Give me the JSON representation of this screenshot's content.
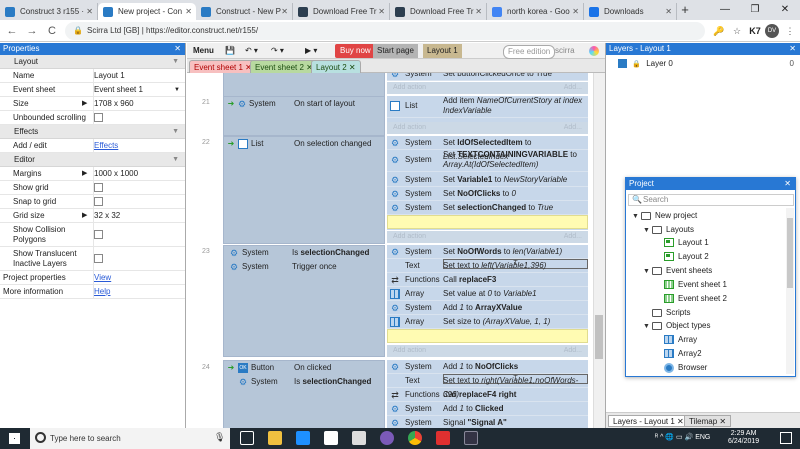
{
  "browser": {
    "tabs": [
      {
        "label": "Construct 3 r155 ·",
        "fav": "#2a7bc4"
      },
      {
        "label": "New project - Con",
        "fav": "#2a7bc4"
      },
      {
        "label": "Construct - New P",
        "fav": "#2a7bc4"
      },
      {
        "label": "Download Free Tr",
        "fav": "#2c3e50"
      },
      {
        "label": "Download Free Tr",
        "fav": "#2c3e50"
      },
      {
        "label": "north korea - Goo",
        "fav": "#4285f4"
      },
      {
        "label": "Downloads",
        "fav": "#1a73e8"
      }
    ],
    "close_glyph": "✕",
    "newtab_glyph": "+",
    "win_min": "—",
    "win_max": "❐",
    "win_close": "✕",
    "back": "←",
    "forward": "→",
    "reload": "C",
    "lock": "🔒",
    "url_origin": "Scirra Ltd [GB]",
    "url_sep": " | ",
    "url": "https://editor.construct.net/r155/",
    "key_icon": "🔑",
    "star": "☆",
    "ext": "K7",
    "avatar": "DV",
    "menu_dots": "⋮"
  },
  "properties": {
    "title": "Properties",
    "close": "✕",
    "sections": {
      "layout": "Layout",
      "effects": "Effects",
      "editor": "Editor"
    },
    "rows": {
      "name_k": "Name",
      "name_v": "Layout 1",
      "eventsheet_k": "Event sheet",
      "eventsheet_v": "Event sheet 1",
      "size_k": "Size",
      "size_v": "1708 x 960",
      "unbounded_k": "Unbounded scrolling",
      "addedit_k": "Add / edit",
      "addedit_v": "Effects",
      "margins_k": "Margins",
      "margins_v": "1000 x 1000",
      "showgrid_k": "Show grid",
      "snap_k": "Snap to grid",
      "gridsize_k": "Grid size",
      "gridsize_v": "32 x 32",
      "collision_k": "Show Collision Polygons",
      "translucent_k": "Show Translucent Inactive Layers",
      "projprops_k": "Project properties",
      "projprops_v": "View",
      "moreinfo_k": "More information",
      "moreinfo_v": "Help"
    }
  },
  "toolbar": {
    "menu": "Menu",
    "save": "💾",
    "undo": "↶ ▾",
    "redo": "↷ ▾",
    "play": "▶ ▾",
    "buy": "Buy now",
    "start": "Start page",
    "layout_tab": "Layout 1",
    "free": "Free edition",
    "brand": "scirra"
  },
  "doctabs": [
    {
      "label": "Event sheet 1",
      "bg": "#f7c0c0",
      "fg": "#b00000"
    },
    {
      "label": "Event sheet 2",
      "bg": "#b8d9a0",
      "fg": "#1c4d10"
    },
    {
      "label": "Layout 2",
      "bg": "#b8e0e0",
      "fg": "#1c4d10"
    }
  ],
  "events": {
    "add_action": "Add action",
    "add_dots": "Add...",
    "top_obj": "System",
    "top_txt": "Set buttonClickedOnce to True",
    "e21": {
      "num": "21",
      "conds": [
        {
          "obj": "System",
          "txt": "On start of layout"
        }
      ],
      "acts": [
        {
          "obj": "List",
          "pre": "Add item ",
          "em": "NameOfCurrentStory at index IndexVariable"
        }
      ]
    },
    "e22": {
      "num": "22",
      "conds": [
        {
          "obj": "List",
          "txt": "On selection changed"
        }
      ],
      "acts": [
        {
          "obj": "System",
          "pre": "Set ",
          "b": "IdOfSelectedItem",
          "mid": " to ",
          "em": "List.SelectedIndex"
        },
        {
          "obj": "System",
          "pre": "Set ",
          "b": "TEXTCONTAININGVARIABLE",
          "mid": " to ",
          "em": "Array.At(IdOfSelectedItem)"
        },
        {
          "obj": "System",
          "pre": "Set ",
          "b": "Variable1",
          "mid": " to ",
          "em": "NewStoryVariable"
        },
        {
          "obj": "System",
          "pre": "Set ",
          "b": "NoOfClicks",
          "mid": " to ",
          "em": "0"
        },
        {
          "obj": "System",
          "pre": "Set ",
          "b": "selectionChanged",
          "mid": " to ",
          "em": "True"
        }
      ]
    },
    "e23": {
      "num": "23",
      "conds": [
        {
          "obj": "System",
          "pre": "Is ",
          "b": "selectionChanged"
        },
        {
          "obj": "System",
          "txt": "Trigger once"
        }
      ],
      "acts": [
        {
          "obj": "System",
          "pre": "Set ",
          "b": "NoOfWords",
          "mid": " to ",
          "em": "len(Variable1)"
        },
        {
          "obj": "Text",
          "pre": "Set text to ",
          "em": "left(Variable1,396)"
        },
        {
          "obj": "Functions",
          "pre": "Call ",
          "b": "replaceF3"
        },
        {
          "obj": "Array",
          "pre": "Set value at ",
          "em": "0",
          "mid": " to ",
          "em2": "Variable1"
        },
        {
          "obj": "System",
          "pre": "Add ",
          "em": "1",
          "mid": " to ",
          "b": "ArrayXValue"
        },
        {
          "obj": "Array",
          "pre": "Set size to ",
          "em": "(ArrayXValue, 1, 1)"
        }
      ]
    },
    "e24": {
      "num": "24",
      "conds": [
        {
          "obj": "Button",
          "txt": "On clicked"
        },
        {
          "obj": "System",
          "pre": "Is ",
          "b": "selectionChanged"
        }
      ],
      "acts": [
        {
          "obj": "System",
          "pre": "Add ",
          "em": "1",
          "mid": " to ",
          "b": "NoOfClicks"
        },
        {
          "obj": "Text",
          "pre": "Set text to ",
          "em": "right(Variable1,noOfWords-396)"
        },
        {
          "obj": "Functions",
          "pre": "Call ",
          "b": "replaceF4 right"
        },
        {
          "obj": "System",
          "pre": "Add ",
          "em": "1",
          "mid": " to ",
          "b": "Clicked"
        },
        {
          "obj": "System",
          "pre": "Signal ",
          "b": "\"Signal A\""
        }
      ]
    }
  },
  "layers": {
    "title": "Layers - Layout 1",
    "close": "✕",
    "layer0": "Layer 0",
    "layer0_count": "0",
    "lock": "🔒",
    "tab1": "Layers - Layout 1",
    "tab2": "Tilemap"
  },
  "project": {
    "title": "Project",
    "close": "✕",
    "search": "Search",
    "tree": {
      "root": "New project",
      "layouts": "Layouts",
      "layout1": "Layout 1",
      "layout2": "Layout 2",
      "eventsheets": "Event sheets",
      "es1": "Event sheet 1",
      "es2": "Event sheet 2",
      "scripts": "Scripts",
      "objtypes": "Object types",
      "array": "Array",
      "array2": "Array2",
      "browser": "Browser"
    }
  },
  "taskbar": {
    "search": "Type here to search",
    "time": "2:29 AM",
    "date": "6/24/2019",
    "tray": "ᴿ ^ 🌐 ▭ 🔊 ENG"
  }
}
